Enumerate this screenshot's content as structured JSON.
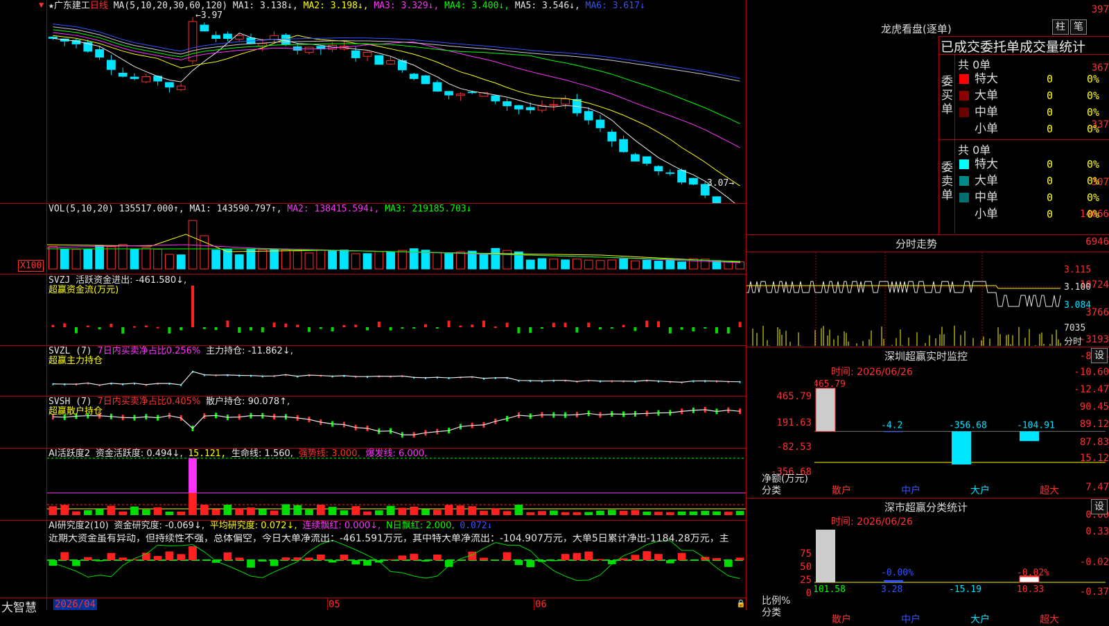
{
  "main_chart": {
    "star": "★",
    "stock_name": "广东建工",
    "period": "日线",
    "ma_params": "MA(5,10,20,30,60,120)",
    "ma1": "MA1: 3.138↓,",
    "ma2": "MA2: 3.198↓,",
    "ma3": "MA3: 3.329↓,",
    "ma4": "MA4: 3.400↓,",
    "ma5": "MA5: 3.546↓,",
    "ma6": "MA6: 3.617↓",
    "high_label": "3.97",
    "low_label": "3.07",
    "y_ticks": [
      "397",
      "367",
      "337",
      "307"
    ]
  },
  "vol_panel": {
    "title": "VOL(5,10,20)",
    "value": "135517.000↑,",
    "ma1": "MA1: 143590.797↑,",
    "ma2": "MA2: 138415.594↓,",
    "ma3": "MA3: 219185.703↓",
    "y_ticks": [
      "14066",
      "6946"
    ],
    "unit": "X100"
  },
  "svzj_panel": {
    "title": "SVZJ",
    "line1": "活跃资金进出: -461.580↓,",
    "line2": "超赢资金流(万元)",
    "y_ticks": [
      "10724",
      "3766",
      "-3193"
    ]
  },
  "svzl_panel": {
    "title": "SVZL (7)",
    "pct": "7日内买卖净占比0.256%",
    "main": "主力持仓: -11.862↓,",
    "line2": "超赢主力持仓",
    "y_ticks": [
      "-8.74",
      "-10.60",
      "-12.47"
    ]
  },
  "svsh_panel": {
    "title": "SVSH (7)",
    "pct": "7日内买卖净占比0.405%",
    "main": "散户持仓: 90.078↑,",
    "line2": "超赢散户持仓",
    "y_ticks": [
      "90.45",
      "89.12",
      "87.83"
    ]
  },
  "ai_active": {
    "title": "AI活跃度2",
    "v1": "资金活跃度: 0.494↓,",
    "v2": "15.121,",
    "v3": "生命线: 1.560,",
    "v4": "强势线: 3.000,",
    "v5": "爆发线: 6.000,",
    "y_ticks": [
      "15.12",
      "7.47",
      "0.00"
    ]
  },
  "ai_research": {
    "title": "AI研究度2(10)",
    "v1": "资金研究度: -0.069↓,",
    "v2": "平均研究度: 0.072↓,",
    "v3": "连续飘红: 0.000↓,",
    "v4": "N日飘红: 2.000,",
    "v5": "0.072↓",
    "comment": "近期大资金虽有异动，但持续性不强，总体偏空，今日大单净流出：-461.591万元，其中特大单净流出：-104.907万元，大单5日累计净出-1184.28万元，主",
    "y_ticks": [
      "0.33",
      "-0.02",
      "-0.37"
    ]
  },
  "bottom_bar": {
    "brand": "大智慧",
    "date_start": "2026/04",
    "month_05": "05",
    "month_06": "06"
  },
  "dragon_tiger": {
    "title": "龙虎看盘(逐单)",
    "btn_bar": "柱",
    "btn_pen": "笔",
    "header": "已成交委托单成交量统计",
    "buy_label": "委买单",
    "sell_label": "委卖单",
    "buy_total": "共 0单",
    "sell_total": "共 0单",
    "buy_rows": [
      {
        "name": "特大",
        "count": "0",
        "pct": "0%",
        "color": "#ff0000"
      },
      {
        "name": "大单",
        "count": "0",
        "pct": "0%",
        "color": "#8b0000"
      },
      {
        "name": "中单",
        "count": "0",
        "pct": "0%",
        "color": "#6a0000"
      },
      {
        "name": "小单",
        "count": "0",
        "pct": "0%",
        "color": "#000000"
      }
    ],
    "sell_rows": [
      {
        "name": "特大",
        "count": "0",
        "pct": "0%",
        "color": "#00ffff"
      },
      {
        "name": "大单",
        "count": "0",
        "pct": "0%",
        "color": "#008b8b"
      },
      {
        "name": "中单",
        "count": "0",
        "pct": "0%",
        "color": "#006f6f"
      },
      {
        "name": "小单",
        "count": "0",
        "pct": "0%",
        "color": "#000000"
      }
    ]
  },
  "intraday": {
    "title": "分时走势",
    "p1": "3.115",
    "p2": "3.100",
    "p3": "3.084",
    "vol": "7035",
    "label": "分时"
  },
  "sz_monitor": {
    "title": "深圳超赢实时监控",
    "btn": "设",
    "time": "时间: 2026/06/26",
    "y_ticks": [
      "465.79",
      "191.63",
      "-82.53",
      "-356.68"
    ],
    "y_title": "净额(万元)",
    "x_title": "分类",
    "categories": [
      "散户",
      "中户",
      "大户",
      "超大"
    ],
    "values": [
      "465.79",
      "-4.2",
      "-356.68",
      "-104.91"
    ]
  },
  "sz_category": {
    "title": "深市超赢分类统计",
    "btn": "设",
    "time": "时间: 2026/06/26",
    "y_ticks": [
      "75",
      "50",
      "25",
      "0"
    ],
    "y_title": "比例%",
    "x_title": "分类",
    "categories": [
      "散户",
      "中户",
      "大户",
      "超大"
    ],
    "top_labels": [
      "",
      "-0.00%",
      "",
      "-0.02%"
    ],
    "bottom_values": [
      "101.58",
      "3.28",
      "-15.19",
      "10.33"
    ]
  }
}
